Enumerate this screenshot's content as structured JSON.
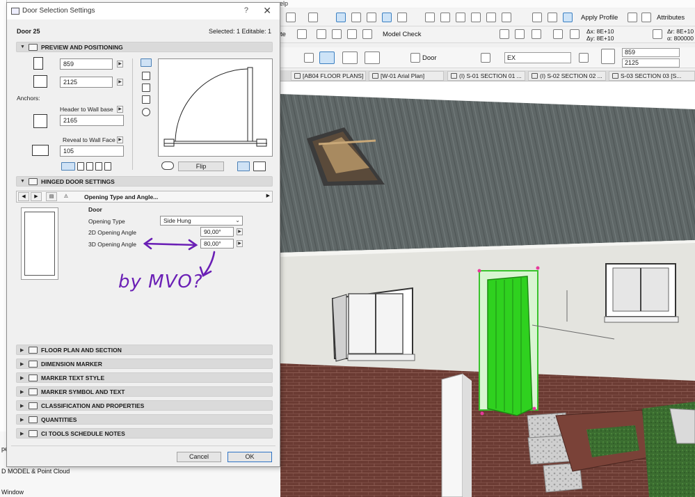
{
  "menu": [
    "elp"
  ],
  "toolbar": {
    "apply_profile": "Apply Profile",
    "attributes": "Attributes",
    "model_check": "Model Check",
    "te_label": "te",
    "dx": "Δx: 8E+10",
    "dy": "Δy: 8E+10",
    "dr": "Δr: 8E+10",
    "alpha": "α: 800000",
    "door_label": "Door",
    "ex_value": "EX",
    "width_value": "859",
    "height_value": "2125"
  },
  "tabs": [
    {
      "label": "[AB04 FLOOR PLANS]"
    },
    {
      "label": "[W-01 Arial Plan]"
    },
    {
      "label": "(I) S-01 SECTION 01 ..."
    },
    {
      "label": "(I) S-02 SECTION 02 ..."
    },
    {
      "label": "S-03 SECTION 03 [S..."
    }
  ],
  "left_panel": {
    "model_item": "D MODEL & Point Cloud",
    "window_item": "Window",
    "pe_item": "pe"
  },
  "dialog": {
    "title": "Door Selection Settings",
    "help": "?",
    "close": "✕",
    "element_name": "Door 25",
    "selected_info": "Selected: 1 Editable: 1",
    "sections": {
      "preview": "PREVIEW AND POSITIONING",
      "hinged": "HINGED DOOR SETTINGS",
      "floor_plan": "FLOOR PLAN AND SECTION",
      "dimension": "DIMENSION MARKER",
      "marker_text": "MARKER TEXT STYLE",
      "marker_symbol": "MARKER SYMBOL AND TEXT",
      "classification": "CLASSIFICATION AND PROPERTIES",
      "quantities": "QUANTITIES",
      "ci_tools": "CI TOOLS SCHEDULE NOTES"
    },
    "width": "859",
    "height": "2125",
    "anchors_label": "Anchors:",
    "header_anchor": "Header to Wall base",
    "header_value": "2165",
    "reveal_anchor": "Reveal to Wall Face",
    "reveal_value": "105",
    "flip_label": "Flip",
    "page_selector": "Opening Type and Angle...",
    "door_heading": "Door",
    "opening_type_label": "Opening Type",
    "opening_type_value": "Side Hung",
    "angle_2d_label": "2D Opening Angle",
    "angle_2d_value": "90,00°",
    "angle_3d_label": "3D Opening Angle",
    "angle_3d_value": "80,00°",
    "cancel_label": "Cancel",
    "ok_label": "OK"
  },
  "annotation": {
    "handwritten_text": "by MVO?",
    "ink_color": "#6a1fb5"
  },
  "colors": {
    "door_green": "#2fd11f",
    "wall": "#e3e3de",
    "brick": "#6a3a32",
    "roof": "#5d6464",
    "lawn": "#3a6e2e"
  }
}
